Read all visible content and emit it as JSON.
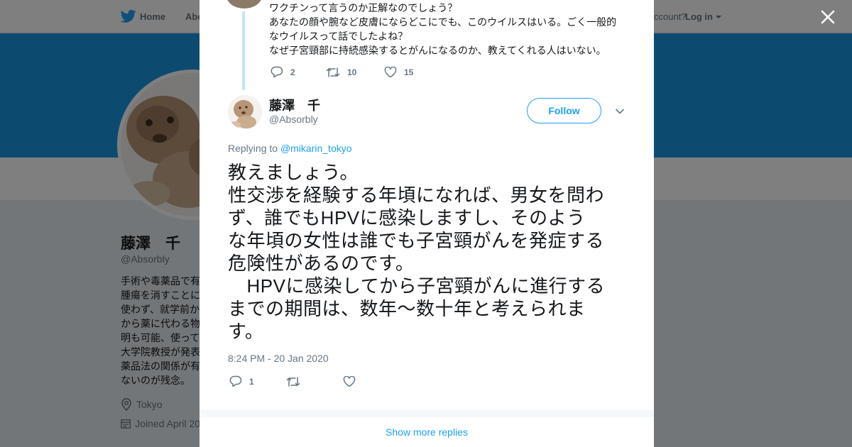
{
  "colors": {
    "brand": "#1da1f2",
    "banner": "#1b95e0",
    "text": "#14171a",
    "muted": "#657786"
  },
  "nav": {
    "home_label": "Home",
    "about_label": "Abo",
    "account_label": "ccount?",
    "login_label": "Log in"
  },
  "profile": {
    "name": "藤澤　千",
    "handle": "@Absorbly",
    "bio_lines": [
      "手術や毒薬品で有",
      "腫瘍を消すことに",
      "使わず、就学前か",
      "から薬に代わる物",
      "明も可能、使って",
      "大学院教授が発表",
      "薬品法の関係が有",
      "ないのが残念。"
    ],
    "location": "Tokyo",
    "joined": "Joined April 20"
  },
  "previous_tweet": {
    "lines": [
      "ワクチンって言うのか正解なのでしょう？",
      "あなたの顔や腕など皮膚にならどこにでも、このウイルスはいる。ごく一般的",
      "なウイルスって話でしたよね？",
      "なぜ子宮頸部に持続感染するとがんになるのか、教えてくれる人はいない。"
    ],
    "reply_count": "2",
    "retweet_count": "10",
    "like_count": "15"
  },
  "tweet": {
    "name": "藤澤　千",
    "handle": "@Absorbly",
    "follow_label": "Follow",
    "replying_prefix": "Replying to",
    "replying_to": "@mikarin_tokyo",
    "text_lines": [
      "教えましょう。",
      "性交渉を経験する年頃になれば、男女を問わ",
      "ず、誰でもHPVに感染しますし、そのよう",
      "な年頃の女性は誰でも子宮頸がんを発症する",
      "危険性があるのです。",
      "　HPVに感染してから子宮頸がんに進行する",
      "までの期間は、数年～数十年と考えられま",
      "す。"
    ],
    "timestamp": "8:24 PM - 20 Jan 2020",
    "reply_count": "1",
    "retweet_count": "",
    "like_count": ""
  },
  "show_more_label": "Show more replies"
}
